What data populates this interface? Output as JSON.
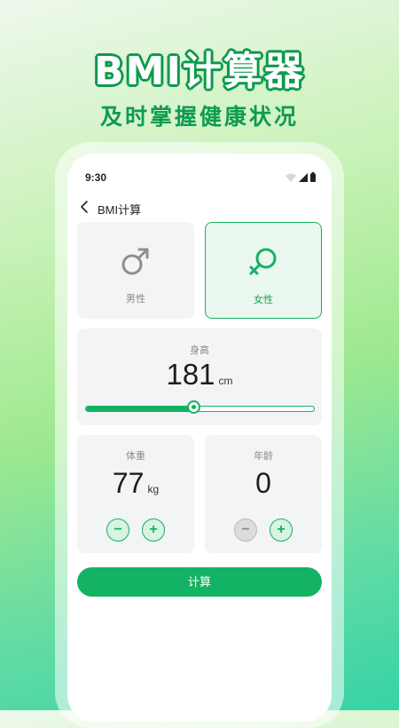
{
  "promo": {
    "title": "BMI计算器",
    "subtitle": "及时掌握健康状况"
  },
  "status_bar": {
    "time": "9:30",
    "icons": [
      "wifi-icon",
      "signal-icon",
      "battery-icon"
    ]
  },
  "nav": {
    "title": "BMI计算",
    "back_icon": "chevron-left-icon"
  },
  "gender": {
    "selected": "female",
    "options": [
      {
        "label": "男性",
        "icon": "male-symbol-icon"
      },
      {
        "label": "女性",
        "icon": "female-symbol-icon"
      }
    ]
  },
  "height": {
    "label": "身高",
    "value": "181",
    "unit": "cm",
    "slider_fraction": 0.47
  },
  "weight": {
    "label": "体重",
    "value": "77",
    "unit": "kg",
    "minus": "−",
    "plus": "+"
  },
  "age": {
    "label": "年龄",
    "value": "0",
    "minus": "−",
    "plus": "+"
  },
  "calculate_button": "计算",
  "colors": {
    "accent": "#14b263",
    "female_card_bg": "#e9f7ef",
    "card_bg": "#f3f4f6"
  }
}
